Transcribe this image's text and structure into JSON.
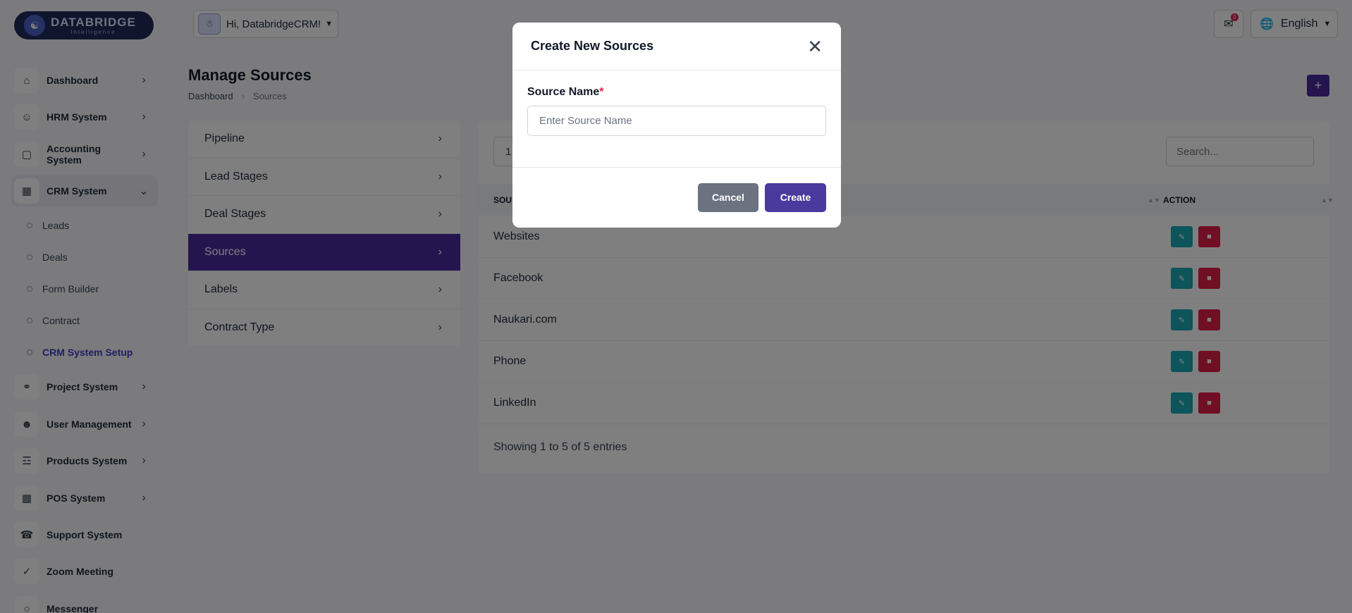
{
  "brand": {
    "name": "DATABRIDGE",
    "tagline": "Intelligence"
  },
  "topbar": {
    "greeting": "Hi, DatabridgeCRM!",
    "notification_count": "0",
    "language": "English"
  },
  "sidebar": {
    "items": [
      {
        "label": "Dashboard",
        "icon": "home-icon"
      },
      {
        "label": "HRM System",
        "icon": "user-icon"
      },
      {
        "label": "Accounting System",
        "icon": "box-icon"
      },
      {
        "label": "CRM System",
        "icon": "crm-icon"
      },
      {
        "label": "Project System",
        "icon": "share-icon"
      },
      {
        "label": "User Management",
        "icon": "users-icon"
      },
      {
        "label": "Products System",
        "icon": "cart-icon"
      },
      {
        "label": "POS System",
        "icon": "pos-icon"
      },
      {
        "label": "Support System",
        "icon": "headset-icon"
      },
      {
        "label": "Zoom Meeting",
        "icon": "user-check-icon"
      },
      {
        "label": "Messenger",
        "icon": "chat-icon"
      }
    ],
    "crm_sub": [
      "Leads",
      "Deals",
      "Form Builder",
      "Contract",
      "CRM System Setup"
    ]
  },
  "page": {
    "title": "Manage Sources",
    "breadcrumb": [
      "Dashboard",
      "Sources"
    ]
  },
  "settings_menu": [
    "Pipeline",
    "Lead Stages",
    "Deal Stages",
    "Sources",
    "Labels",
    "Contract Type"
  ],
  "table": {
    "per_page": "1",
    "search_placeholder": "Search...",
    "headers": [
      "SOU",
      "ACTION"
    ],
    "rows": [
      "Websites",
      "Facebook",
      "Naukari.com",
      "Phone",
      "LinkedIn"
    ],
    "entries_text": "Showing 1 to 5 of 5 entries"
  },
  "modal": {
    "title": "Create New Sources",
    "field_label": "Source Name",
    "required_mark": "*",
    "placeholder": "Enter Source Name",
    "cancel_label": "Cancel",
    "create_label": "Create"
  },
  "colors": {
    "primary": "#4b2b9e",
    "edit": "#1aa9b7",
    "delete": "#e11d48",
    "cancel": "#6b7280"
  }
}
